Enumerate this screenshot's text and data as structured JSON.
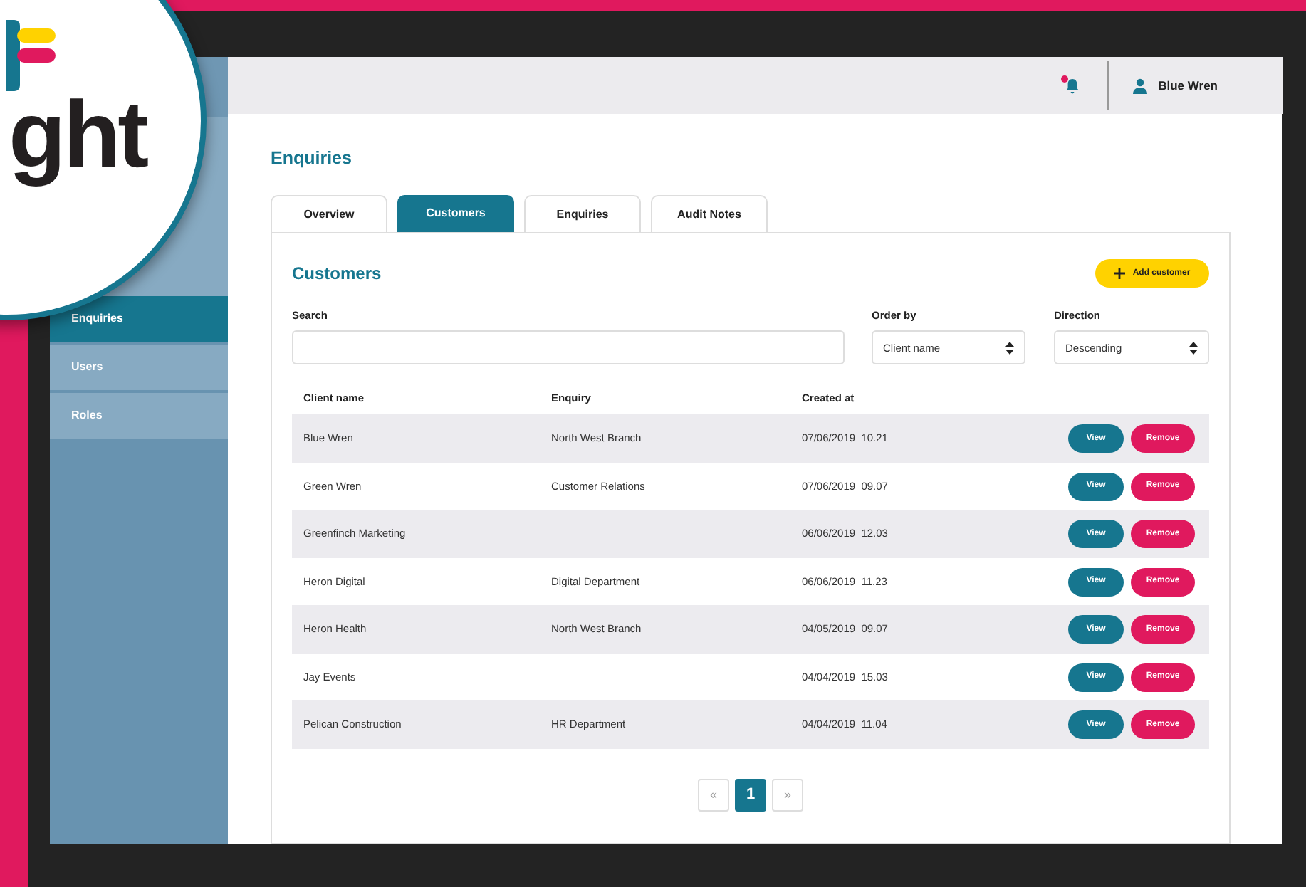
{
  "logo": {
    "text": "ght"
  },
  "header": {
    "notification_unread": true,
    "user_name": "Blue Wren"
  },
  "sidebar": {
    "items": [
      {
        "label": "Enquiries",
        "selected": true
      },
      {
        "label": "Users",
        "selected": false
      },
      {
        "label": "Roles",
        "selected": false
      }
    ]
  },
  "page_title": "Enquiries",
  "tabs": [
    {
      "label": "Overview",
      "selected": false
    },
    {
      "label": "Customers",
      "selected": true
    },
    {
      "label": "Enquiries",
      "selected": false
    },
    {
      "label": "Audit Notes",
      "selected": false
    }
  ],
  "panel": {
    "title": "Customers",
    "add_button": "Add customer",
    "search": {
      "label": "Search"
    },
    "order_by": {
      "label": "Order by",
      "value": "Client name"
    },
    "direction": {
      "label": "Direction",
      "value": "Descending"
    },
    "table": {
      "columns": [
        "Client name",
        "Enquiry",
        "Created at"
      ],
      "rows": [
        {
          "client": "Blue Wren",
          "enquiry": "North West Branch",
          "date": "07/06/2019",
          "time": "10.21",
          "view": "View",
          "remove": "Remove"
        },
        {
          "client": "Green Wren",
          "enquiry": "Customer Relations",
          "date": "07/06/2019",
          "time": "09.07",
          "view": "View",
          "remove": "Remove"
        },
        {
          "client": "Greenfinch Marketing",
          "enquiry": "",
          "date": "06/06/2019",
          "time": "12.03",
          "view": "View",
          "remove": "Remove"
        },
        {
          "client": "Heron Digital",
          "enquiry": "Digital Department",
          "date": "06/06/2019",
          "time": "11.23",
          "view": "View",
          "remove": "Remove"
        },
        {
          "client": "Heron Health",
          "enquiry": "North West Branch",
          "date": "04/05/2019",
          "time": "09.07",
          "view": "View",
          "remove": "Remove"
        },
        {
          "client": "Jay Events",
          "enquiry": "",
          "date": "04/04/2019",
          "time": "15.03",
          "view": "View",
          "remove": "Remove"
        },
        {
          "client": "Pelican Construction",
          "enquiry": "HR Department",
          "date": "04/04/2019",
          "time": "11.04",
          "view": "View",
          "remove": "Remove"
        }
      ]
    },
    "pagination": {
      "prev": "«",
      "pages": [
        {
          "label": "1",
          "selected": true
        }
      ],
      "next": "»"
    }
  }
}
